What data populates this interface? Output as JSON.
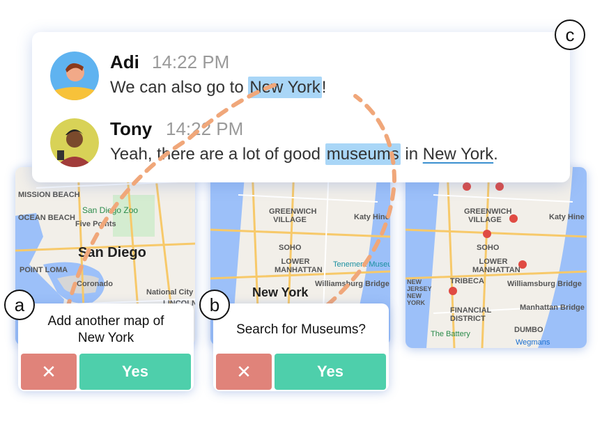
{
  "chat": {
    "messages": [
      {
        "author": "Adi",
        "time": "14:22 PM",
        "text_before": "We can also go to ",
        "highlight": "New York",
        "text_after": "!"
      },
      {
        "author": "Tony",
        "time": "14:22 PM",
        "text_before": "Yeah, there are a lot of good ",
        "highlight": "museums",
        "text_middle": " in ",
        "underline": "New York",
        "text_after": "."
      }
    ]
  },
  "map1": {
    "labels": [
      "MISSION BEACH",
      "OCEAN BEACH",
      "POINT LOMA",
      "Five Points",
      "Coronado",
      "National City",
      "LINCOLN PARK"
    ],
    "green_labels": [
      "San Diego Zoo"
    ],
    "city": "San Diego"
  },
  "map2": {
    "labels": [
      "GREENWICH VILLAGE",
      "SOHO",
      "LOWER MANHATTAN",
      "Williamsburg Bridge",
      "Katy Hine Co"
    ],
    "green_labels": [
      "Tenement Museum"
    ],
    "city": "New York"
  },
  "map3": {
    "labels": [
      "GREENWICH VILLAGE",
      "SOHO",
      "LOWER MANHATTAN",
      "TRIBECA",
      "FINANCIAL DISTRICT",
      "Williamsburg Bridge",
      "Manhattan Bridge",
      "DUMBO",
      "Katy Hine Co",
      "NEW JERSEY NEW YORK"
    ],
    "green_labels": [
      "The Battery"
    ],
    "blue_labels": [
      "Wegmans"
    ]
  },
  "cards": {
    "a": {
      "badge": "a",
      "question": "Add another map of New York",
      "no": "✕",
      "yes": "Yes"
    },
    "b": {
      "badge": "b",
      "question": "Search for Museums?",
      "no": "✕",
      "yes": "Yes"
    },
    "c": {
      "badge": "c"
    }
  },
  "colors": {
    "highlight": "#a9d6f7",
    "yes": "#4ecfab",
    "no": "#e0837a",
    "dash": "#f0a77a",
    "water": "#9cc0f9",
    "land": "#f2efe9"
  }
}
